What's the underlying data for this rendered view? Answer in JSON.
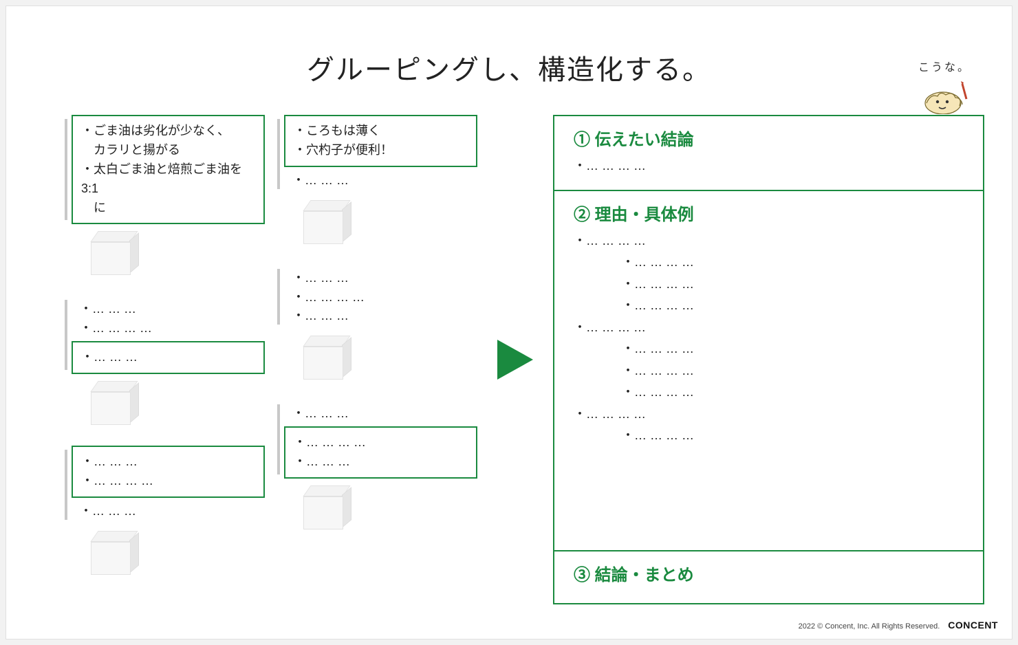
{
  "title": "グルーピングし、構造化する。",
  "annotation": "こうな。",
  "ellipsis3": "… … …",
  "ellipsis4": "… … … …",
  "left": {
    "col1": {
      "g1_box": [
        "・ごま油は劣化が少なく、",
        "　カラリと揚がる",
        "・太白ごま油と焙煎ごま油を3:1",
        "　に"
      ],
      "g2_plain": [
        "・… … …",
        "・… … … …"
      ],
      "g2_box": [
        "・… … …"
      ],
      "g3_box": [
        "・… … …",
        "・… … … …"
      ],
      "g3_plain": [
        "・… … …"
      ]
    },
    "col2": {
      "g1_box": [
        "・ころもは薄く",
        "・穴杓子が便利！"
      ],
      "g1_plain": [
        "・… … …"
      ],
      "g2_plain": [
        "・… … …",
        "・… … … …",
        "・… … …"
      ],
      "g3_plain": [
        "・… … …"
      ],
      "g3_box": [
        "・… … … …",
        "・… … …"
      ]
    }
  },
  "right": {
    "s1": {
      "head": "① 伝えたい結論",
      "lines": [
        {
          "t": "・… … … …",
          "lvl": 1
        }
      ]
    },
    "s2": {
      "head": "② 理由・具体例",
      "lines": [
        {
          "t": "・… … … …",
          "lvl": 1
        },
        {
          "t": "・… … … …",
          "lvl": 2
        },
        {
          "t": "・… … … …",
          "lvl": 2
        },
        {
          "t": "・… … … …",
          "lvl": 2
        },
        {
          "t": "・… … … …",
          "lvl": 1
        },
        {
          "t": "・… … … …",
          "lvl": 2
        },
        {
          "t": "・… … … …",
          "lvl": 2
        },
        {
          "t": "・… … … …",
          "lvl": 2
        },
        {
          "t": "・… … … …",
          "lvl": 1
        },
        {
          "t": "・… … … …",
          "lvl": 2
        }
      ]
    },
    "s3": {
      "head": "③ 結論・まとめ"
    }
  },
  "footer": {
    "copyright": "2022 © Concent, Inc. All Rights Reserved.",
    "brand": "CONCENT"
  },
  "colors": {
    "green": "#1a8a3f"
  }
}
